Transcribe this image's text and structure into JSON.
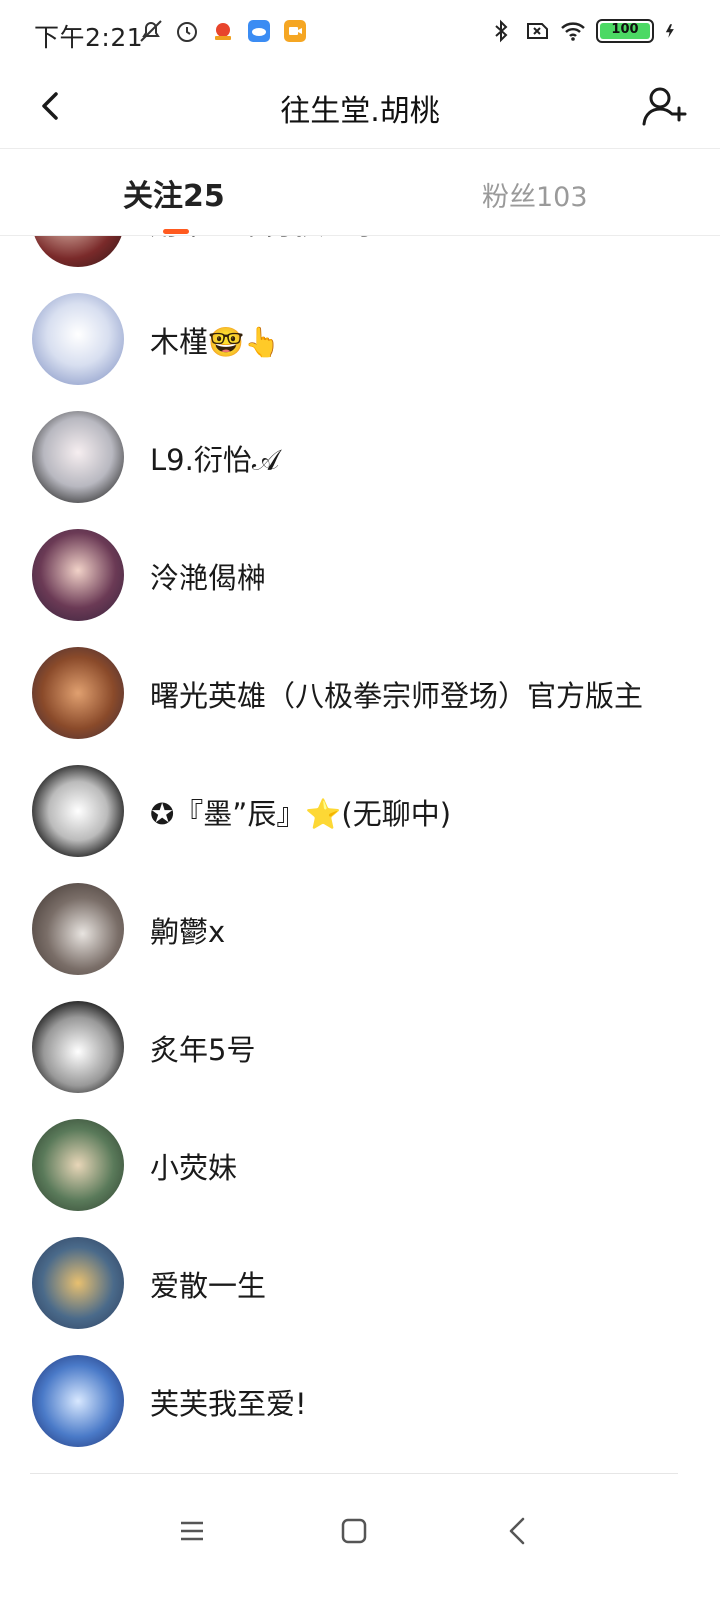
{
  "status_bar": {
    "time": "下午2:21",
    "battery": "100"
  },
  "header": {
    "title": "往生堂.胡桃"
  },
  "tabs": {
    "following": "关注25",
    "fans": "粉丝103"
  },
  "list": [
    {
      "name": "用某人草身换公子"
    },
    {
      "name": "木槿🤓👆"
    },
    {
      "name": "L9.衍怡𝒜"
    },
    {
      "name": "泠滟偈榊"
    },
    {
      "name": "曙光英雄（八极拳宗师登场）官方版主"
    },
    {
      "name": "✪『墨”辰』⭐(无聊中)"
    },
    {
      "name": "齁鬱x"
    },
    {
      "name": "炙年5号"
    },
    {
      "name": "小荧妹"
    },
    {
      "name": "爱散一生"
    },
    {
      "name": "芙芙我至爱!"
    }
  ],
  "colors": {
    "accent": "#ff5a1f",
    "tab_inactive": "#9a9a9a"
  },
  "icons": {
    "back": "chevron-left-icon",
    "add_user": "add-user-icon"
  }
}
